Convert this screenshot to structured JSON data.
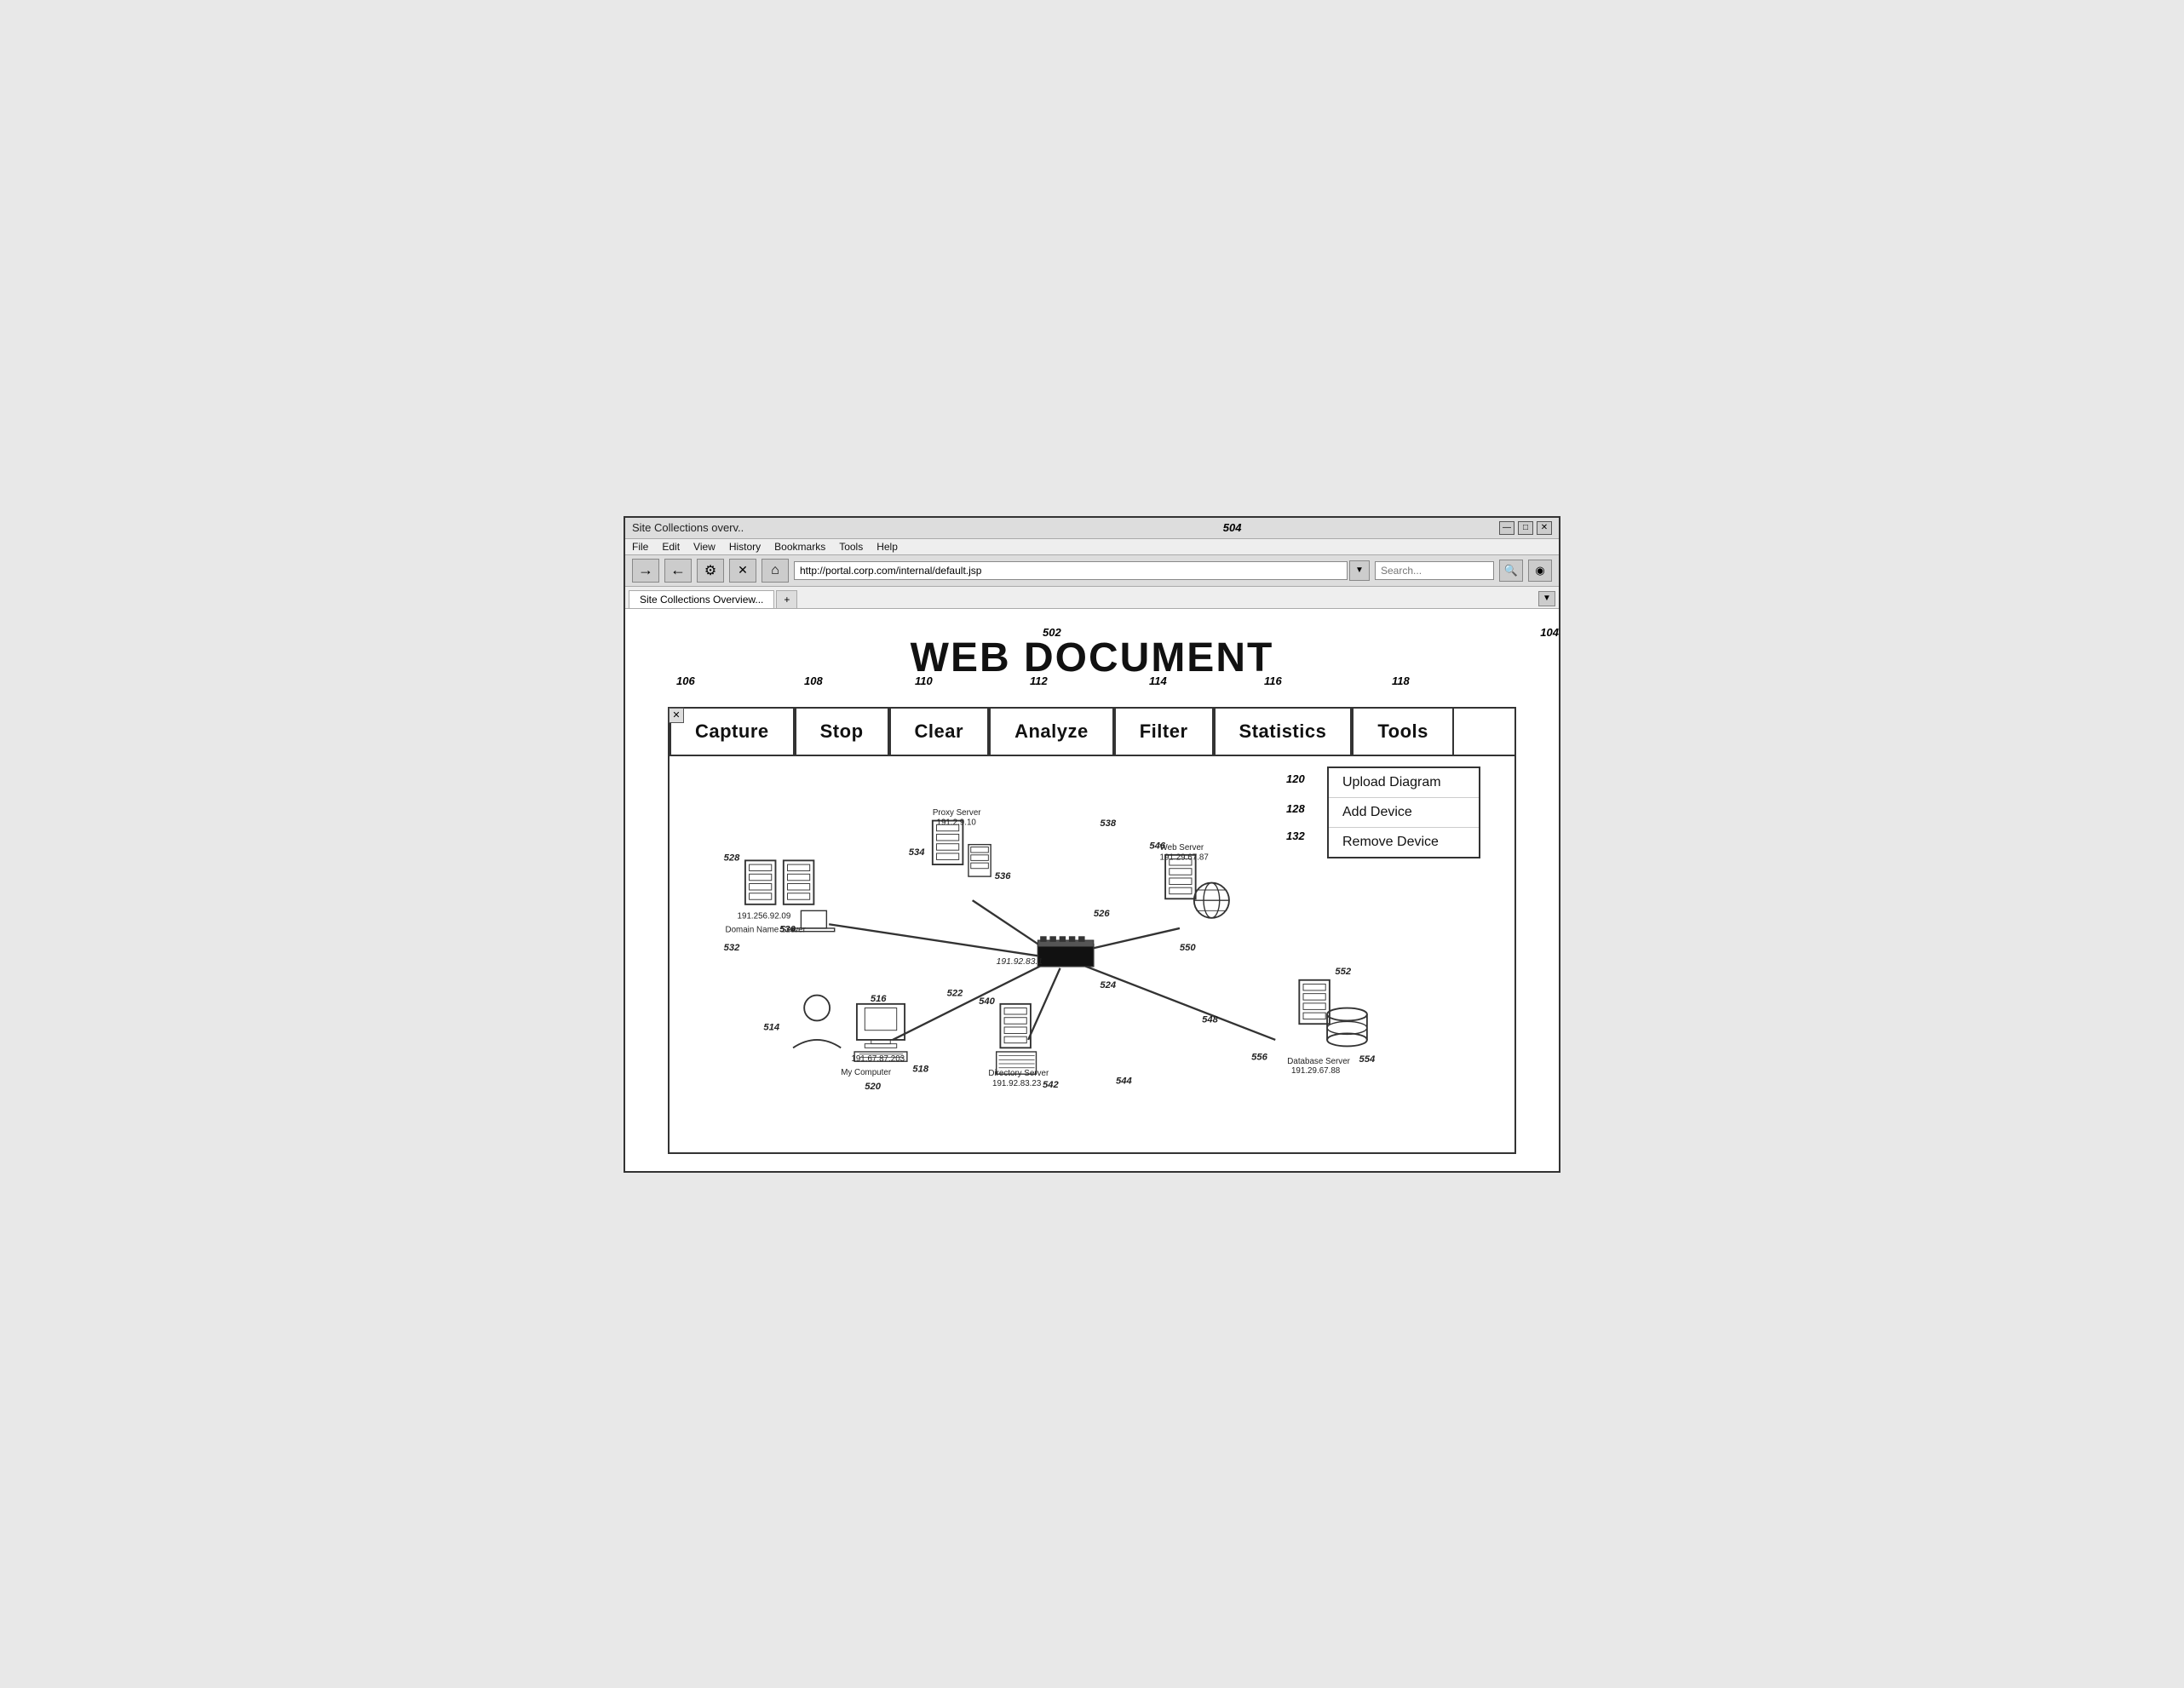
{
  "browser": {
    "title": "Site Collections overv..",
    "url": "http://portal.corp.com/internal/default.jsp",
    "controls": [
      "minimize",
      "maximize",
      "close"
    ],
    "menu": [
      "File",
      "Edit",
      "View",
      "History",
      "Bookmarks",
      "Tools",
      "Help"
    ],
    "tab_label": "Site Collections Overview...",
    "new_tab_label": "+",
    "back_icon": "←",
    "forward_icon": "→",
    "refresh_icon": "⚙",
    "stop_icon": "✕",
    "home_icon": "⌂",
    "dropdown_icon": "▼",
    "search_icon": "🔍",
    "camera_icon": "◉"
  },
  "web_doc_title": "WEB DOCUMENT",
  "ref_numbers": {
    "r504": "504",
    "r502": "502",
    "r104": "104",
    "r106": "106",
    "r108": "108",
    "r110": "110",
    "r112": "112",
    "r114": "114",
    "r116": "116",
    "r118": "118",
    "r120": "120",
    "r128": "128",
    "r132": "132",
    "r514": "514",
    "r516": "516",
    "r518": "518",
    "r520": "520",
    "r522": "522",
    "r524": "524",
    "r526": "526",
    "r528": "528",
    "r530": "530",
    "r532": "532",
    "r534": "534",
    "r536": "536",
    "r538": "538",
    "r540": "540",
    "r542": "542",
    "r544": "544",
    "r546": "546",
    "r548": "548",
    "r550": "550",
    "r552": "552",
    "r554": "554",
    "r556": "556"
  },
  "toolbar_buttons": [
    {
      "id": "capture",
      "label": "Capture"
    },
    {
      "id": "stop",
      "label": "Stop"
    },
    {
      "id": "clear",
      "label": "Clear"
    },
    {
      "id": "analyze",
      "label": "Analyze"
    },
    {
      "id": "filter",
      "label": "Filter"
    },
    {
      "id": "statistics",
      "label": "Statistics"
    },
    {
      "id": "tools",
      "label": "Tools"
    }
  ],
  "tools_dropdown": [
    {
      "id": "upload-diagram",
      "label": "Upload Diagram"
    },
    {
      "id": "add-device",
      "label": "Add Device"
    },
    {
      "id": "remove-device",
      "label": "Remove Device"
    }
  ],
  "devices": [
    {
      "id": "dns-server",
      "label": "Domain Name Server",
      "ip": "191.256.92.09",
      "ref": "528/530/532"
    },
    {
      "id": "proxy-server",
      "label": "Proxy Server\n191.2.9.10",
      "ref": "534/536/538"
    },
    {
      "id": "web-server",
      "label": "Web Server\n191.29.67.87",
      "ref": "546/550"
    },
    {
      "id": "hub",
      "label": "191.92.83.1",
      "ref": "526/524"
    },
    {
      "id": "my-computer",
      "label": "My Computer",
      "ip": "191.67.87.203",
      "ref": "514/516/518/520"
    },
    {
      "id": "directory-server",
      "label": "Directory Server\n191.92.83.23",
      "ref": "540/542/544"
    },
    {
      "id": "database-server",
      "label": "Database Server\n191.29.67.88",
      "ref": "552/554/556"
    }
  ]
}
